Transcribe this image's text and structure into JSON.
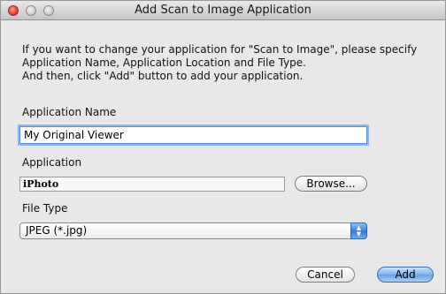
{
  "window": {
    "title": "Add Scan to Image Application"
  },
  "intro": {
    "lines": [
      "If you want to change your application for \"Scan to Image\", please specify",
      "Application Name, Application Location and File Type.",
      "And then, click \"Add\" button to add your application."
    ]
  },
  "app_name": {
    "label": "Application Name",
    "value": "My Original Viewer"
  },
  "application": {
    "label": "Application",
    "value": "iPhoto",
    "browse_label": "Browse..."
  },
  "file_type": {
    "label": "File Type",
    "selected": "JPEG (*.jpg)"
  },
  "buttons": {
    "cancel": "Cancel",
    "add": "Add"
  },
  "icons": {
    "close": "close-icon",
    "minimize": "minimize-icon",
    "zoom": "zoom-icon",
    "select_arrows": "chevron-updown-icon"
  },
  "colors": {
    "focus_ring": "#8fb7ea",
    "default_button": "#6aa2e7"
  }
}
